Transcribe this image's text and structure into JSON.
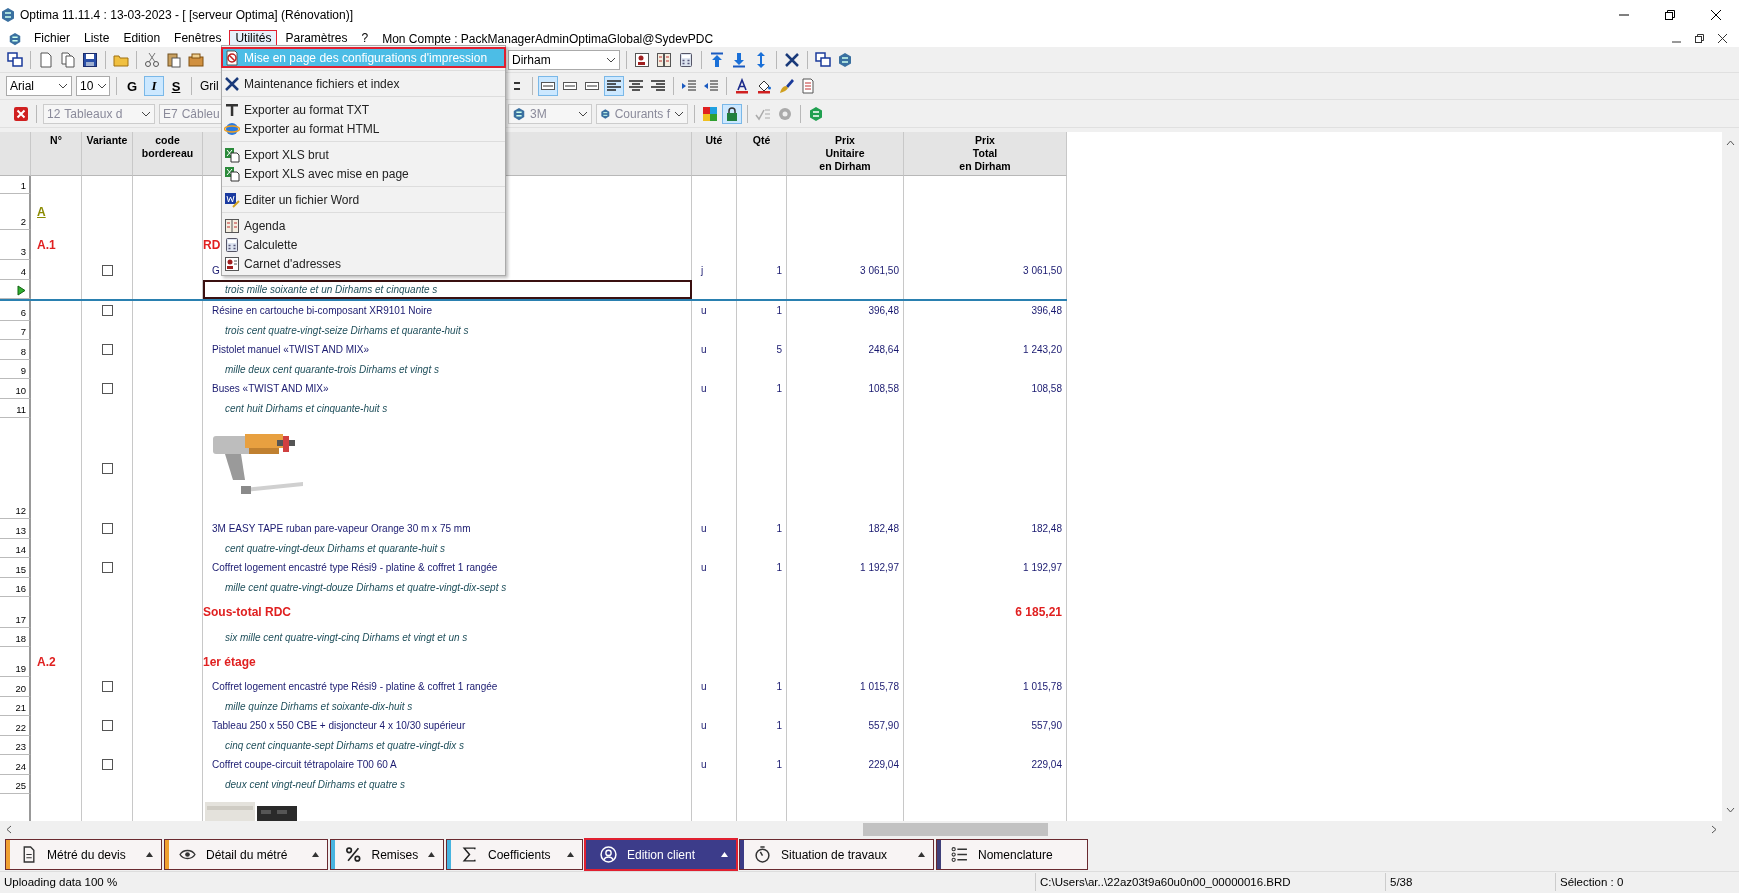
{
  "window": {
    "title": "Optima 11.11.4 : 13-03-2023 - [ [serveur Optima] (Rénovation)]"
  },
  "menubar": {
    "items": [
      {
        "label": "Fichier",
        "selected": false
      },
      {
        "label": "Liste",
        "selected": false
      },
      {
        "label": "Edition",
        "selected": false
      },
      {
        "label": "Fenêtres",
        "selected": false
      },
      {
        "label": "Utilités",
        "selected": true
      },
      {
        "label": "Paramètres",
        "selected": false
      },
      {
        "label": "?",
        "selected": false
      }
    ],
    "account": "Mon Compte : PackManagerAdminOptimaGlobal@SydevPDC"
  },
  "toolbar1": {
    "currency": "Dirham"
  },
  "toolbar2": {
    "font": "Arial",
    "size": "10",
    "format_buttons": [
      {
        "label": "G",
        "selected": false
      },
      {
        "label": "I",
        "selected": true
      },
      {
        "label": "S",
        "selected": false
      }
    ],
    "grid_label": "Gril",
    "line_styles": [
      {
        "selected": true
      },
      {
        "selected": false
      },
      {
        "selected": false
      }
    ],
    "alignments": [
      {
        "selected": true
      },
      {
        "selected": false
      },
      {
        "selected": false
      }
    ]
  },
  "toolbar3": {
    "combos": [
      {
        "code": "12",
        "label": "Tableaux d"
      },
      {
        "code": "E7",
        "label": "Câbleu"
      }
    ],
    "right_combos": [
      {
        "label": "3M"
      },
      {
        "label": "Courants f"
      }
    ],
    "lock": {
      "selected": true
    }
  },
  "menu": {
    "groups": [
      [
        {
          "label": "Mise en page des configurations d'impression",
          "selected": true
        }
      ],
      [
        {
          "label": "Maintenance fichiers et index",
          "selected": false
        }
      ],
      [
        {
          "label": "Exporter au format TXT",
          "selected": false
        },
        {
          "label": "Exporter au format HTML",
          "selected": false
        }
      ],
      [
        {
          "label": "Export XLS brut",
          "selected": false
        },
        {
          "label": "Export XLS avec mise en page",
          "selected": false
        }
      ],
      [
        {
          "label": "Editer un fichier Word",
          "selected": false
        }
      ],
      [
        {
          "label": "Agenda",
          "selected": false
        },
        {
          "label": "Calculette",
          "selected": false
        },
        {
          "label": "Carnet d'adresses",
          "selected": false
        }
      ]
    ]
  },
  "table": {
    "columns": [
      {},
      {
        "lines": [
          "N°"
        ]
      },
      {
        "lines": [
          "Variante"
        ]
      },
      {
        "lines": [
          "code",
          "bordereau"
        ]
      },
      {},
      {
        "lines": [
          "Uté"
        ]
      },
      {
        "lines": [
          "Qté"
        ]
      },
      {
        "lines": [
          "Prix",
          "Unitaire",
          "en Dirham"
        ]
      },
      {
        "lines": [
          "Prix",
          "Total",
          "en Dirham"
        ]
      }
    ],
    "rows": [
      {
        "kind": "blank",
        "num": "1",
        "selected": false
      },
      {
        "kind": "chapter",
        "num": "2",
        "code": "A",
        "selected": false
      },
      {
        "kind": "section",
        "num": "3",
        "code": "A.1",
        "designation": "RD",
        "selected": false
      },
      {
        "kind": "item",
        "num": "4",
        "checked": false,
        "selected": false,
        "designation": "G",
        "unit": "j",
        "qty": "1",
        "unit_price": "3 061,50",
        "total": "3 061,50"
      },
      {
        "kind": "words",
        "selected": true,
        "text": "trois mille soixante et un Dirhams et cinquante s"
      },
      {
        "kind": "item",
        "num": "6",
        "checked": false,
        "selected": false,
        "designation": "Résine en cartouche bi-composant XR9101 Noire",
        "unit": "u",
        "qty": "1",
        "unit_price": "396,48",
        "total": "396,48"
      },
      {
        "kind": "words",
        "num": "7",
        "selected": false,
        "text": "trois cent  quatre-vingt-seize Dirhams et quarante-huit s"
      },
      {
        "kind": "item",
        "num": "8",
        "checked": false,
        "selected": false,
        "designation": "Pistolet manuel «TWIST AND MIX»",
        "unit": "u",
        "qty": "5",
        "unit_price": "248,64",
        "total": "1 243,20"
      },
      {
        "kind": "words",
        "num": "9",
        "selected": false,
        "text": "mille deux cent quarante-trois Dirhams et vingt s"
      },
      {
        "kind": "item",
        "num": "10",
        "checked": false,
        "selected": false,
        "designation": "Buses «TWIST AND MIX»",
        "unit": "u",
        "qty": "1",
        "unit_price": "108,58",
        "total": "108,58"
      },
      {
        "kind": "words",
        "num": "11",
        "selected": false,
        "text": "cent huit Dirhams et cinquante-huit s"
      },
      {
        "kind": "picture",
        "num": "12",
        "checked": false,
        "selected": false
      },
      {
        "kind": "item",
        "num": "13",
        "checked": false,
        "selected": false,
        "designation": "3M EASY TAPE ruban pare-vapeur Orange 30 m x 75 mm",
        "unit": "u",
        "qty": "1",
        "unit_price": "182,48",
        "total": "182,48"
      },
      {
        "kind": "words",
        "num": "14",
        "selected": false,
        "text": "cent quatre-vingt-deux Dirhams et quarante-huit s"
      },
      {
        "kind": "item",
        "num": "15",
        "checked": false,
        "selected": false,
        "designation": "Coffret logement encastré type Rési9 - platine & coffret 1 rangée",
        "unit": "u",
        "qty": "1",
        "unit_price": "1 192,97",
        "total": "1 192,97"
      },
      {
        "kind": "words",
        "num": "16",
        "selected": false,
        "text": "mille cent  quatre-vingt-douze Dirhams et  quatre-vingt-dix-sept s"
      },
      {
        "kind": "subtotal",
        "num": "17",
        "selected": false,
        "designation": "Sous-total RDC",
        "total": "6 185,21"
      },
      {
        "kind": "words",
        "num": "18",
        "selected": false,
        "text": "six mille cent quatre-vingt-cinq Dirhams et vingt et un s"
      },
      {
        "kind": "section",
        "num": "19",
        "code": "A.2",
        "designation": "1er étage",
        "selected": false
      },
      {
        "kind": "item",
        "num": "20",
        "checked": false,
        "selected": false,
        "designation": "Coffret logement encastré type Rési9 - platine & coffret 1 rangée",
        "unit": "u",
        "qty": "1",
        "unit_price": "1 015,78",
        "total": "1 015,78"
      },
      {
        "kind": "words",
        "num": "21",
        "selected": false,
        "text": "mille quinze Dirhams et  soixante-dix-huit s"
      },
      {
        "kind": "item",
        "num": "22",
        "checked": false,
        "selected": false,
        "designation": "Tableau 250 x 550 CBE + disjoncteur 4 x 10/30 supérieur",
        "unit": "u",
        "qty": "1",
        "unit_price": "557,90",
        "total": "557,90"
      },
      {
        "kind": "words",
        "num": "23",
        "selected": false,
        "text": "cinq cent cinquante-sept Dirhams et  quatre-vingt-dix s"
      },
      {
        "kind": "item",
        "num": "24",
        "checked": false,
        "selected": false,
        "designation": "Coffret coupe-circuit tétrapolaire T00 60 A",
        "unit": "u",
        "qty": "1",
        "unit_price": "229,04",
        "total": "229,04"
      },
      {
        "kind": "words",
        "num": "25",
        "selected": false,
        "text": "deux cent vingt-neuf Dirhams et quatre s"
      },
      {
        "kind": "picture",
        "selected": false
      }
    ]
  },
  "bottom_tabs": [
    {
      "label": "Métré du devis",
      "selected": false,
      "color": "#f0a030"
    },
    {
      "label": "Détail du métré",
      "selected": false,
      "color": "#f0a030"
    },
    {
      "label": "Remises",
      "selected": false,
      "color": "#48b4e0"
    },
    {
      "label": "Coefficients",
      "selected": false,
      "color": "#48b4e0"
    },
    {
      "label": "Edition client",
      "selected": true,
      "color": "#3c3c86"
    },
    {
      "label": "Situation de travaux",
      "selected": false,
      "color": "#3c3c86"
    },
    {
      "label": "Nomenclature",
      "selected": false,
      "color": "#40407a"
    }
  ],
  "status_bar": {
    "message": "Uploading data 100 %",
    "path": "C:\\Users\\ar..\\22az03t9a60u0n00_00000016.BRD",
    "page": "5/38",
    "selection": "Sélection : 0"
  }
}
